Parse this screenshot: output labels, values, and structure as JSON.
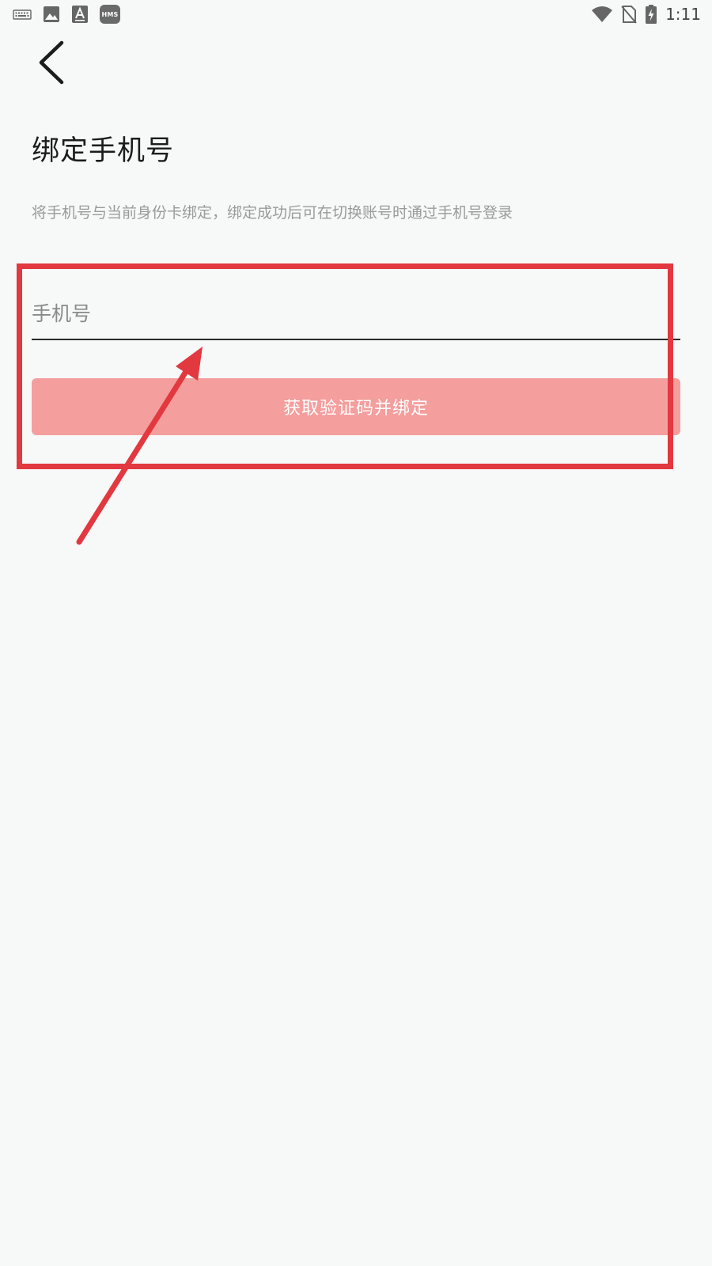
{
  "status_bar": {
    "time": "1:11",
    "left_icons": [
      "keyboard-icon",
      "image-icon",
      "font-icon",
      "hms-icon"
    ],
    "hms_badge": "HMS",
    "right_icons": [
      "wifi-icon",
      "no-sim-icon",
      "battery-charging-icon"
    ]
  },
  "header": {
    "back_icon": "chevron-left-icon"
  },
  "page": {
    "title": "绑定手机号",
    "subtitle": "将手机号与当前身份卡绑定，绑定成功后可在切换账号时通过手机号登录"
  },
  "form": {
    "phone_placeholder": "手机号",
    "phone_value": "",
    "submit_label": "获取验证码并绑定"
  },
  "colors": {
    "background": "#f7f8f8",
    "button_fill": "#f49e9d",
    "annotation": "#e2383f",
    "subtitle_text": "#9a9a9a"
  }
}
